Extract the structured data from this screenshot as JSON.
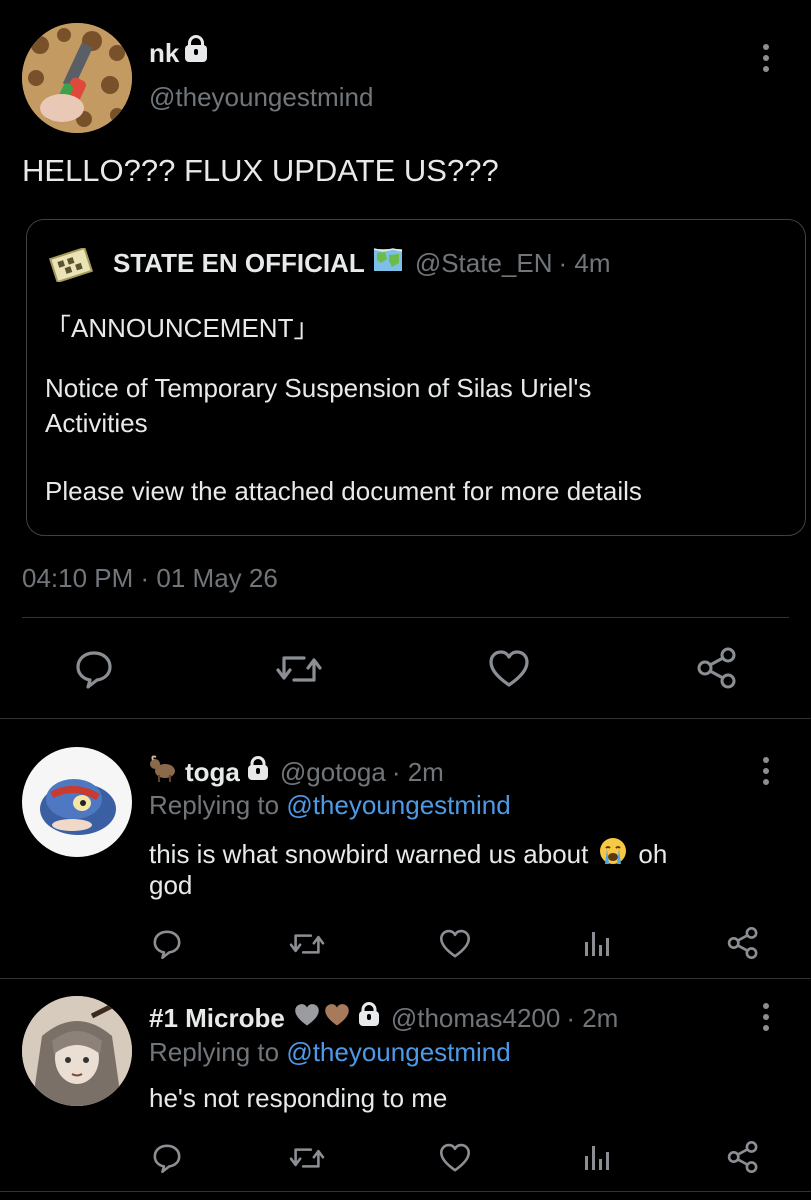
{
  "main_tweet": {
    "display_name": "nk",
    "handle": "@theyoungestmind",
    "text": "HELLO??? FLUX UPDATE US???",
    "timestamp": "04:10 PM · 01 May 26",
    "quoted": {
      "display_name": "STATE EN OFFICIAL",
      "handle": "@State_EN",
      "time": "· 4m",
      "line1": "「ANNOUNCEMENT」",
      "line2": "Notice of Temporary Suspension of Silas Uriel's",
      "line3": "Activities",
      "line4": "Please view the attached document for more details"
    }
  },
  "replies": [
    {
      "display_name": "toga",
      "handle": "@gotoga",
      "time": "· 2m",
      "replying_prefix": "Replying to",
      "replying_to": "@theyoungestmind",
      "text_line1": "this is what snowbird warned us about",
      "text_line1_end": "oh",
      "text_line2": "god"
    },
    {
      "display_name": "#1 Microbe",
      "handle": "@thomas4200",
      "time": "· 2m",
      "replying_prefix": "Replying to",
      "replying_to": "@theyoungestmind",
      "text_line1": "he's not responding to me"
    }
  ],
  "icons": {
    "reply": "reply-icon",
    "retweet": "retweet-icon",
    "like": "heart-icon",
    "stats": "stats-icon",
    "share": "share-icon",
    "more": "more-icon"
  },
  "colors": {
    "background": "#000000",
    "text": "#e7e9ea",
    "muted": "#71767b",
    "link": "#4e9ae6",
    "divider": "#2f3336"
  }
}
